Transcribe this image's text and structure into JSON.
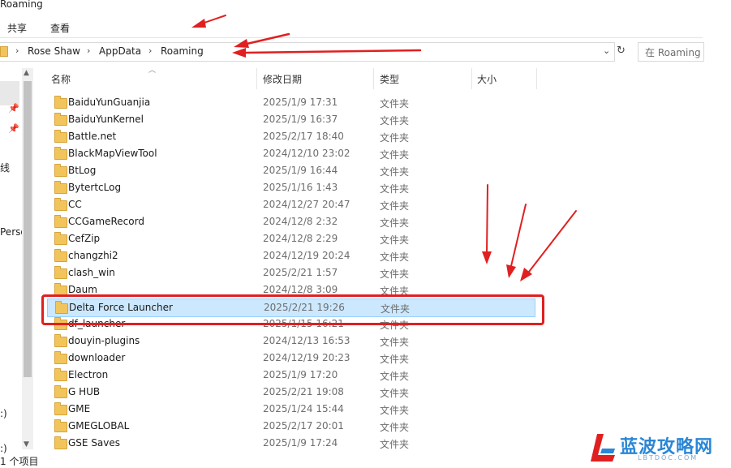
{
  "window": {
    "title": "Roaming"
  },
  "ribbon": {
    "tabs": [
      "共享",
      "查看"
    ]
  },
  "address": {
    "crumbs": [
      "Rose Shaw",
      "AppData",
      "Roaming"
    ],
    "search_placeholder": "在 Roaming"
  },
  "nav_pane": {
    "fragments": [
      "线",
      "Perso",
      ":)",
      ":)"
    ]
  },
  "columns": {
    "name": "名称",
    "date": "修改日期",
    "type": "类型",
    "size": "大小"
  },
  "rows": [
    {
      "name": "BaiduYunGuanjia",
      "date": "2025/1/9 17:31",
      "type": "文件夹"
    },
    {
      "name": "BaiduYunKernel",
      "date": "2025/1/9 16:37",
      "type": "文件夹"
    },
    {
      "name": "Battle.net",
      "date": "2025/2/17 18:40",
      "type": "文件夹"
    },
    {
      "name": "BlackMapViewTool",
      "date": "2024/12/10 23:02",
      "type": "文件夹"
    },
    {
      "name": "BtLog",
      "date": "2025/1/9 16:44",
      "type": "文件夹"
    },
    {
      "name": "BytertcLog",
      "date": "2025/1/16 1:43",
      "type": "文件夹"
    },
    {
      "name": "CC",
      "date": "2024/12/27 20:47",
      "type": "文件夹"
    },
    {
      "name": "CCGameRecord",
      "date": "2024/12/8 2:32",
      "type": "文件夹"
    },
    {
      "name": "CefZip",
      "date": "2024/12/8 2:29",
      "type": "文件夹"
    },
    {
      "name": "changzhi2",
      "date": "2024/12/19 20:24",
      "type": "文件夹"
    },
    {
      "name": "clash_win",
      "date": "2025/2/21 1:57",
      "type": "文件夹"
    },
    {
      "name": "Daum",
      "date": "2024/12/8 3:09",
      "type": "文件夹"
    },
    {
      "name": "Delta Force Launcher",
      "date": "2025/2/21 19:26",
      "type": "文件夹"
    },
    {
      "name": "df_launcher",
      "date": "2025/1/15 16:21",
      "type": "文件夹"
    },
    {
      "name": "douyin-plugins",
      "date": "2024/12/13 16:53",
      "type": "文件夹"
    },
    {
      "name": "downloader",
      "date": "2024/12/19 20:23",
      "type": "文件夹"
    },
    {
      "name": "Electron",
      "date": "2025/1/9 17:20",
      "type": "文件夹"
    },
    {
      "name": "G HUB",
      "date": "2025/2/21 19:08",
      "type": "文件夹"
    },
    {
      "name": "GME",
      "date": "2025/1/24 15:44",
      "type": "文件夹"
    },
    {
      "name": "GMEGLOBAL",
      "date": "2025/2/17 20:01",
      "type": "文件夹"
    },
    {
      "name": "GSE Saves",
      "date": "2025/1/9 17:24",
      "type": "文件夹"
    }
  ],
  "selected_row": "Delta Force Launcher",
  "status": {
    "text": "1 个项目"
  },
  "watermark": {
    "title": "蓝波攻略网",
    "sub": "LBTDOC.COM"
  },
  "colors": {
    "annotation": "#e02020",
    "selection": "#cce8ff",
    "folder": "#f2c55c",
    "watermark": "#2a86d6"
  }
}
